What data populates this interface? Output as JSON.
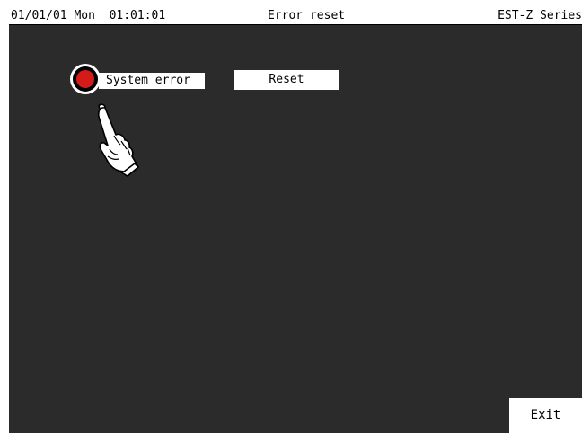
{
  "header": {
    "datetime": "01/01/01 Mon  01:01:01",
    "title": "Error reset",
    "series": "EST-Z Series"
  },
  "error": {
    "label": "System error",
    "lamp_color": "#d51a1a",
    "reset_label": "Reset"
  },
  "pointer": {
    "icon": "pointing-hand-icon"
  },
  "footer": {
    "exit_label": "Exit"
  },
  "colors": {
    "background": "#2b2b2b",
    "panel": "#ffffff",
    "lamp": "#d51a1a"
  }
}
